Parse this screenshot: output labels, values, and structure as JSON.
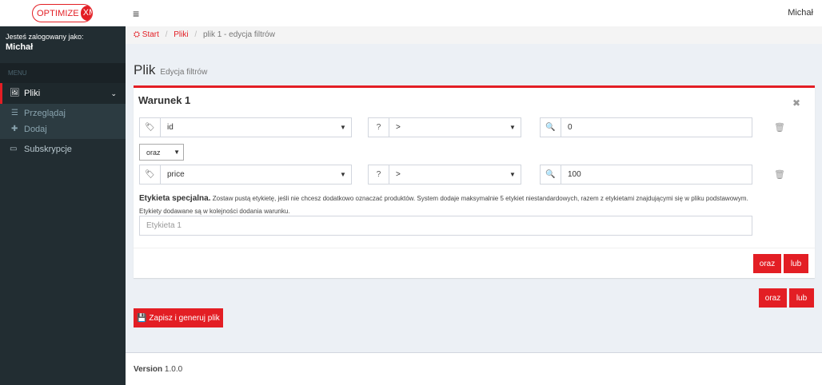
{
  "logo": {
    "part1": "OPTIMIZE",
    "part2": "XML"
  },
  "header": {
    "hamburger": "≡",
    "user": "Michał"
  },
  "sidebar": {
    "logged_label": "Jesteś zalogowany jako:",
    "user_name": "Michał",
    "menu_header": "MENU",
    "items": [
      {
        "label": "Pliki",
        "icon": "image-icon"
      },
      {
        "label": "Subskrypcje",
        "icon": "card-icon"
      }
    ],
    "submenu": [
      {
        "label": "Przeglądaj",
        "icon": "list-icon"
      },
      {
        "label": "Dodaj",
        "icon": "plus-icon"
      }
    ]
  },
  "breadcrumb": {
    "start": "Start",
    "files": "Pliki",
    "current": "plik 1 - edycja filtrów"
  },
  "page": {
    "title": "Plik",
    "subtitle": "Edycja filtrów"
  },
  "condition": {
    "title": "Warunek 1",
    "rows": [
      {
        "field": "id",
        "operator": ">",
        "value": "0"
      },
      {
        "field": "price",
        "operator": ">",
        "value": "100"
      }
    ],
    "join": "oraz",
    "special_bold": "Etykieta specjalna.",
    "special_text": "Zostaw pustą etykietę, jeśli nie chcesz dodatkowo oznaczać produktów. System dodaje maksymalnie 5 etykiet niestandardowych, razem z etykietami znajdującymi się w pliku podstawowym.",
    "special_text2": "Etykiety dodawane są w kolejności dodania warunku.",
    "label_placeholder": "Etykieta 1",
    "btn_and": "oraz",
    "btn_or": "lub"
  },
  "outer": {
    "btn_and": "oraz",
    "btn_or": "lub"
  },
  "save_button": "Zapisz i generuj plik",
  "version": {
    "label": "Version",
    "value": "1.0.0"
  }
}
